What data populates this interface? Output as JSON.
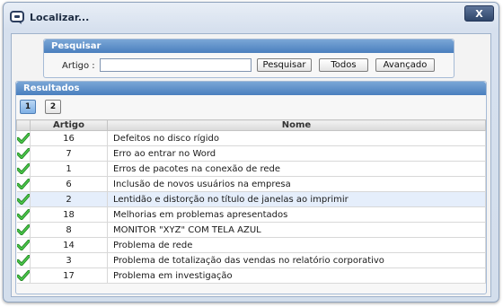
{
  "window": {
    "title": "Localizar...",
    "close_label": "X"
  },
  "search": {
    "header": "Pesquisar",
    "label": "Artigo :",
    "value": "",
    "placeholder": "",
    "search_button": "Pesquisar",
    "all_button": "Todos",
    "advanced_button": "Avançado"
  },
  "results": {
    "header": "Resultados",
    "pages": [
      "1",
      "2"
    ],
    "current_page": "1",
    "columns": [
      "",
      "Artigo",
      "Nome"
    ],
    "rows": [
      {
        "artigo": "16",
        "nome": "Defeitos no disco rígido"
      },
      {
        "artigo": "7",
        "nome": "Erro ao entrar no Word"
      },
      {
        "artigo": "1",
        "nome": "Erros de pacotes na conexão de rede"
      },
      {
        "artigo": "6",
        "nome": "Inclusão de novos usuários na empresa"
      },
      {
        "artigo": "2",
        "nome": "Lentidão e distorção no título de janelas ao imprimir"
      },
      {
        "artigo": "18",
        "nome": "Melhorias em problemas apresentados"
      },
      {
        "artigo": "8",
        "nome": "MONITOR \"XYZ\" COM TELA AZUL"
      },
      {
        "artigo": "14",
        "nome": "Problema de rede"
      },
      {
        "artigo": "3",
        "nome": "Problema de totalização das vendas no relatório corporativo"
      },
      {
        "artigo": "17",
        "nome": "Problema em investigação"
      }
    ]
  },
  "colors": {
    "header_blue": "#4a7fbe",
    "check_green": "#2fa52f",
    "highlight_row": "#e5eefb"
  },
  "icons": {
    "row_status": "check-icon",
    "window": "chat-icon"
  }
}
